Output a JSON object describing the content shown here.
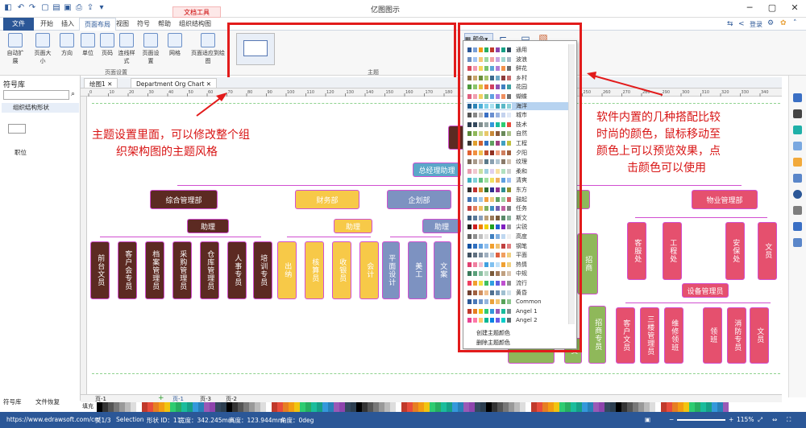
{
  "window": {
    "title": "亿图图示",
    "doc_tools_tab": "文档工具",
    "login": "登录"
  },
  "tabs": [
    "文件",
    "开始",
    "插入",
    "页面布局",
    "视图",
    "符号",
    "帮助",
    "组织结构图"
  ],
  "ribbon": {
    "buttons": [
      "自动扩展",
      "页面大小",
      "方向",
      "单位",
      "页码",
      "页面设置",
      "网格",
      "页面适应到绘图"
    ],
    "connector_label": "连线样式",
    "group_page_setup": "页面设置",
    "group_theme": "主题",
    "color_btn": "颜色",
    "connector_btn": "连接线",
    "background_btn": "背景"
  },
  "left_panel": {
    "title": "符号库",
    "category": "组织结构形状",
    "shape_label": "职位",
    "bottom_tab1": "符号库",
    "bottom_tab2": "文件恢复"
  },
  "doc_tabs": [
    "绘图1",
    "Department Org Chart"
  ],
  "ruler_ticks": [
    "0",
    "10",
    "20",
    "30",
    "40",
    "50",
    "60",
    "70",
    "80",
    "90",
    "100",
    "110",
    "120",
    "130",
    "140",
    "150",
    "160",
    "170",
    "180",
    "190",
    "200",
    "210",
    "220",
    "230",
    "240",
    "250",
    "260",
    "270",
    "280",
    "290",
    "300",
    "310",
    "320",
    "330",
    "340"
  ],
  "org": {
    "gm_assist": "总经理助理",
    "depts": {
      "zonghe": "综合管理部",
      "caiwu": "财务部",
      "qihua": "企划部",
      "wuye": "物业管理部"
    },
    "assist": "助理",
    "zonghe_children": [
      "前台文员",
      "客户会专员",
      "档案管理员",
      "采购管理员",
      "仓库管理员",
      "人事专员",
      "培训专员"
    ],
    "caiwu_children": [
      "出纳",
      "核算员",
      "收银员",
      "会计"
    ],
    "qihua_children": [
      "平面设计",
      "美工",
      "文案"
    ],
    "wuye_children": [
      "客服处",
      "工程处",
      "安保处",
      "文员"
    ],
    "equipment_mgr": "设备管理员",
    "wuye_sub": [
      "客户文员",
      "三楼管理员",
      "维修领班",
      "领班",
      "消防专员",
      "文员"
    ],
    "hidden_partial": [
      "招商专员",
      "招商",
      "员"
    ]
  },
  "theme_menu": {
    "schemes": [
      "通用",
      "波浪",
      "鲜花",
      "乡村",
      "花园",
      "蝴蝶",
      "海洋",
      "城市",
      "技术",
      "自然",
      "工程",
      "夕阳",
      "纹理",
      "柔和",
      "清爽",
      "东方",
      "鼓起",
      "任务",
      "斯文",
      "尖锐",
      "高度",
      "钢笔",
      "平面",
      "热情",
      "中规",
      "流行",
      "黄昏",
      "Common",
      "Angel 1",
      "Angel 2"
    ],
    "selected": "海洋",
    "create": "创建主题颜色",
    "delete": "删除主题颜色"
  },
  "annotations": {
    "left": [
      "主题设置里面，可以修改整个组",
      "织架构图的主题风格"
    ],
    "right": [
      "软件内置的几种搭配比较",
      "时尚的颜色，鼠标移动至",
      "颜色上可以预览效果，点",
      "击颜色可以使用"
    ]
  },
  "pages": {
    "current": "页-1",
    "add": "+",
    "tabs": [
      "页-1",
      "页-3",
      "页-2"
    ],
    "fill_label": "填充"
  },
  "status": {
    "url": "https://www.edrawsoft.com/cn/",
    "page": "页1/3",
    "mode": "Selection",
    "shape_id": "形状 ID：11",
    "width": "宽度：342.245mm",
    "height": "高度：123.944mm",
    "angle": "角度：0deg",
    "zoom": "115%"
  },
  "colors": {
    "accent": "#2b5797",
    "annotation": "#d81414",
    "highlight": "#e21b1b",
    "dept_dark": "#5c2a22",
    "dept_yellow": "#f7c948",
    "dept_blue": "#7d92c1",
    "dept_pink": "#e5506e"
  }
}
